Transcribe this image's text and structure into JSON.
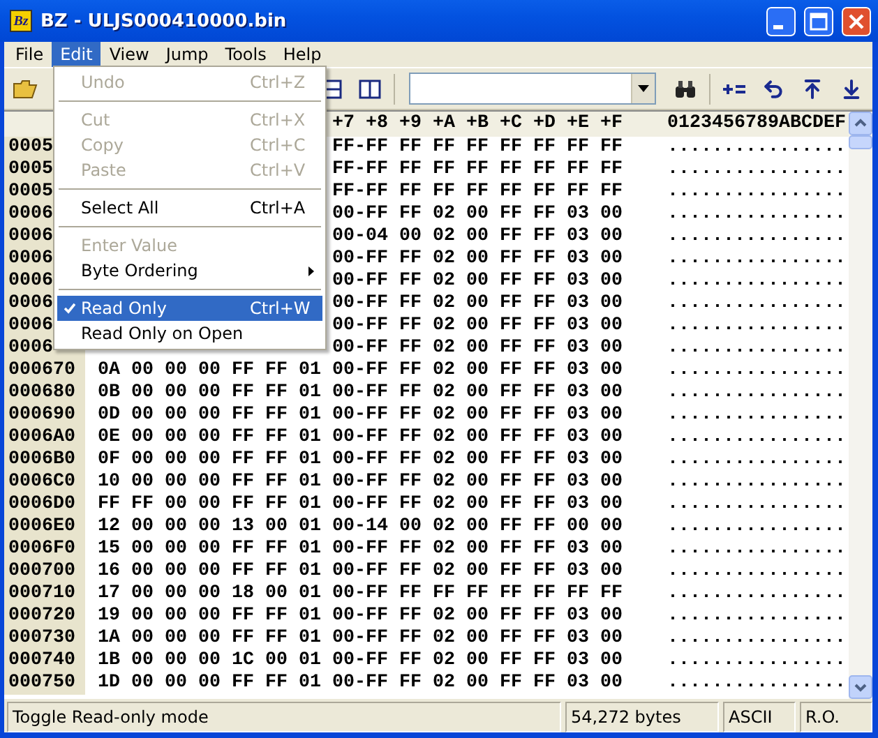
{
  "window": {
    "icon_label": "Bz",
    "title": "BZ - ULJS000410000.bin"
  },
  "menu_bar": [
    {
      "label": "File",
      "selected": false
    },
    {
      "label": "Edit",
      "selected": true
    },
    {
      "label": "View",
      "selected": false
    },
    {
      "label": "Jump",
      "selected": false
    },
    {
      "label": "Tools",
      "selected": false
    },
    {
      "label": "Help",
      "selected": false
    }
  ],
  "edit_menu": [
    {
      "kind": "item",
      "label": "Undo",
      "shortcut": "Ctrl+Z",
      "disabled": true,
      "checked": false,
      "selected": false
    },
    {
      "kind": "separator"
    },
    {
      "kind": "item",
      "label": "Cut",
      "shortcut": "Ctrl+X",
      "disabled": true,
      "checked": false,
      "selected": false
    },
    {
      "kind": "item",
      "label": "Copy",
      "shortcut": "Ctrl+C",
      "disabled": true,
      "checked": false,
      "selected": false
    },
    {
      "kind": "item",
      "label": "Paste",
      "shortcut": "Ctrl+V",
      "disabled": true,
      "checked": false,
      "selected": false
    },
    {
      "kind": "separator"
    },
    {
      "kind": "item",
      "label": "Select All",
      "shortcut": "Ctrl+A",
      "disabled": false,
      "checked": false,
      "selected": false
    },
    {
      "kind": "separator"
    },
    {
      "kind": "item",
      "label": "Enter Value",
      "disabled": true,
      "checked": false,
      "selected": false
    },
    {
      "kind": "submenu",
      "label": "Byte Ordering",
      "disabled": false,
      "checked": false,
      "selected": false
    },
    {
      "kind": "separator"
    },
    {
      "kind": "item",
      "label": "Read Only",
      "shortcut": "Ctrl+W",
      "disabled": false,
      "checked": true,
      "selected": true
    },
    {
      "kind": "item",
      "label": "Read Only on Open",
      "disabled": false,
      "checked": false,
      "selected": false
    }
  ],
  "hex_view": {
    "header": {
      "bytes_right": "+7 +8 +9 +A +B +C +D +E +F",
      "ascii": "0123456789ABCDEF"
    },
    "rows": [
      {
        "address": "0005",
        "bytes_right": "FF-FF FF FF FF FF FF FF FF",
        "ascii": "................"
      },
      {
        "address": "0005",
        "bytes_right": "FF-FF FF FF FF FF FF FF FF",
        "ascii": "................"
      },
      {
        "address": "0005",
        "bytes_right": "FF-FF FF FF FF FF FF FF FF",
        "ascii": "................"
      },
      {
        "address": "0006",
        "bytes_right": "00-FF FF 02 00 FF FF 03 00",
        "ascii": "................"
      },
      {
        "address": "0006",
        "bytes_right": "00-04 00 02 00 FF FF 03 00",
        "ascii": "................"
      },
      {
        "address": "0006",
        "bytes_right": "00-FF FF 02 00 FF FF 03 00",
        "ascii": "................"
      },
      {
        "address": "0006",
        "bytes_right": "00-FF FF 02 00 FF FF 03 00",
        "ascii": "................"
      },
      {
        "address": "0006",
        "bytes_right": "00-FF FF 02 00 FF FF 03 00",
        "ascii": "................"
      },
      {
        "address": "0006",
        "bytes_right": "00-FF FF 02 00 FF FF 03 00",
        "ascii": "................"
      },
      {
        "address": "0006",
        "bytes_right": "00-FF FF 02 00 FF FF 03 00",
        "ascii": "................"
      },
      {
        "address": "000670",
        "bytes_left": "0A 00 00 00 FF FF 01",
        "bytes_right": "00-FF FF 02 00 FF FF 03 00",
        "ascii": "................"
      },
      {
        "address": "000680",
        "bytes_left": "0B 00 00 00 FF FF 01",
        "bytes_right": "00-FF FF 02 00 FF FF 03 00",
        "ascii": "................"
      },
      {
        "address": "000690",
        "bytes_left": "0D 00 00 00 FF FF 01",
        "bytes_right": "00-FF FF 02 00 FF FF 03 00",
        "ascii": "................"
      },
      {
        "address": "0006A0",
        "bytes_left": "0E 00 00 00 FF FF 01",
        "bytes_right": "00-FF FF 02 00 FF FF 03 00",
        "ascii": "................"
      },
      {
        "address": "0006B0",
        "bytes_left": "0F 00 00 00 FF FF 01",
        "bytes_right": "00-FF FF 02 00 FF FF 03 00",
        "ascii": "................"
      },
      {
        "address": "0006C0",
        "bytes_left": "10 00 00 00 FF FF 01",
        "bytes_right": "00-FF FF 02 00 FF FF 03 00",
        "ascii": "................"
      },
      {
        "address": "0006D0",
        "bytes_left": "FF FF 00 00 FF FF 01",
        "bytes_right": "00-FF FF 02 00 FF FF 03 00",
        "ascii": "................"
      },
      {
        "address": "0006E0",
        "bytes_left": "12 00 00 00 13 00 01",
        "bytes_right": "00-14 00 02 00 FF FF 00 00",
        "ascii": "................"
      },
      {
        "address": "0006F0",
        "bytes_left": "15 00 00 00 FF FF 01",
        "bytes_right": "00-FF FF 02 00 FF FF 03 00",
        "ascii": "................"
      },
      {
        "address": "000700",
        "bytes_left": "16 00 00 00 FF FF 01",
        "bytes_right": "00-FF FF 02 00 FF FF 03 00",
        "ascii": "................"
      },
      {
        "address": "000710",
        "bytes_left": "17 00 00 00 18 00 01",
        "bytes_right": "00-FF FF FF FF FF FF FF FF",
        "ascii": "................"
      },
      {
        "address": "000720",
        "bytes_left": "19 00 00 00 FF FF 01",
        "bytes_right": "00-FF FF 02 00 FF FF 03 00",
        "ascii": "................"
      },
      {
        "address": "000730",
        "bytes_left": "1A 00 00 00 FF FF 01",
        "bytes_right": "00-FF FF 02 00 FF FF 03 00",
        "ascii": "................"
      },
      {
        "address": "000740",
        "bytes_left": "1B 00 00 00 1C 00 01",
        "bytes_right": "00-FF FF 02 00 FF FF 03 00",
        "ascii": "................"
      },
      {
        "address": "000750",
        "bytes_left": "1D 00 00 00 FF FF 01",
        "bytes_right": "00-FF FF 02 00 FF FF 03 00",
        "ascii": "................"
      }
    ]
  },
  "status_bar": {
    "message": "Toggle Read-only mode",
    "size": "54,272 bytes",
    "encoding": "ASCII",
    "mode": "R.O."
  }
}
